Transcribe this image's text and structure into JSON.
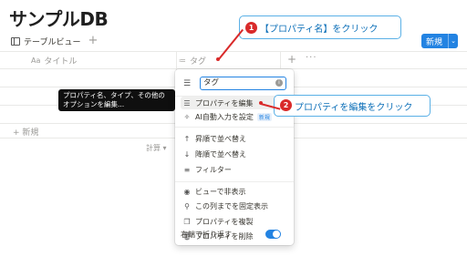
{
  "page": {
    "title": "サンプルDB"
  },
  "viewbar": {
    "view_label": "テーブルビュー",
    "add_view": "+"
  },
  "new_button": {
    "label": "新規",
    "chevron": "⌄"
  },
  "columns": [
    {
      "icon": "Aa",
      "label": "タイトル"
    },
    {
      "icon": "≔",
      "label": "タグ"
    }
  ],
  "column_add": "+",
  "column_more": "···",
  "table": {
    "new_row": "+ 新規",
    "calc": "計算 ▾"
  },
  "tooltip": {
    "text": "プロパティ名、タイプ、その他のオプションを編集..."
  },
  "menu": {
    "search_value": "タグ",
    "items": [
      {
        "icon": "☰",
        "label": "プロパティを編集"
      },
      {
        "icon": "✧",
        "label": "AI自動入力を設定",
        "badge": "新規"
      },
      {
        "icon": "↑",
        "label": "昇順で並べ替え"
      },
      {
        "icon": "↓",
        "label": "降順で並べ替え"
      },
      {
        "icon": "≡",
        "label": "フィルター"
      },
      {
        "icon": "◉",
        "label": "ビューで非表示"
      },
      {
        "icon": "⚲",
        "label": "この列までを固定表示"
      },
      {
        "icon": "❐",
        "label": "プロパティを複製"
      },
      {
        "icon": "🗑",
        "label": "プロパティを削除"
      },
      {
        "icon": "↵",
        "label": "右端で折り返す"
      }
    ]
  },
  "annotations": {
    "callout1": {
      "number": "1",
      "text": "【プロパティ名】をクリック"
    },
    "callout2": {
      "number": "2",
      "text": "プロパティを編集をクリック"
    }
  },
  "colors": {
    "accent": "#2383e2",
    "annotation_red": "#d92a2a",
    "callout_border": "#5ab0e6",
    "callout_text": "#0c6fb8"
  }
}
